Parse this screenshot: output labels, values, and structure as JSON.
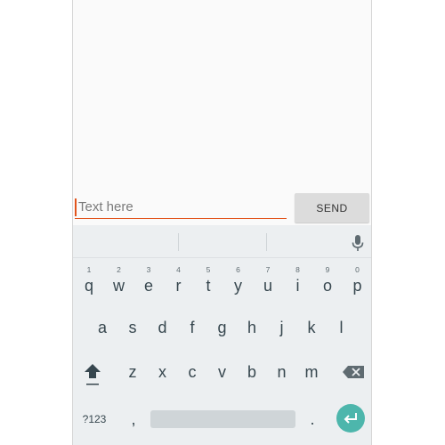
{
  "compose": {
    "input_value": "",
    "input_placeholder": "Text here",
    "send_label": "SEND"
  },
  "keyboard": {
    "row1": [
      {
        "label": "q",
        "hint": "1"
      },
      {
        "label": "w",
        "hint": "2"
      },
      {
        "label": "e",
        "hint": "3"
      },
      {
        "label": "r",
        "hint": "4"
      },
      {
        "label": "t",
        "hint": "5"
      },
      {
        "label": "y",
        "hint": "6"
      },
      {
        "label": "u",
        "hint": "7"
      },
      {
        "label": "i",
        "hint": "8"
      },
      {
        "label": "o",
        "hint": "9"
      },
      {
        "label": "p",
        "hint": "0"
      }
    ],
    "row2": [
      "a",
      "s",
      "d",
      "f",
      "g",
      "h",
      "j",
      "k",
      "l"
    ],
    "row3": [
      "z",
      "x",
      "c",
      "v",
      "b",
      "n",
      "m"
    ],
    "symbols_label": "?123",
    "comma_label": ",",
    "period_label": ".",
    "icons": {
      "mic": "mic-icon",
      "shift": "shift-icon",
      "backspace": "backspace-icon",
      "enter": "enter-icon"
    },
    "colors": {
      "accent": "#e2541c",
      "enter": "#4db6ac",
      "keyboard_bg": "#eceff1"
    }
  }
}
